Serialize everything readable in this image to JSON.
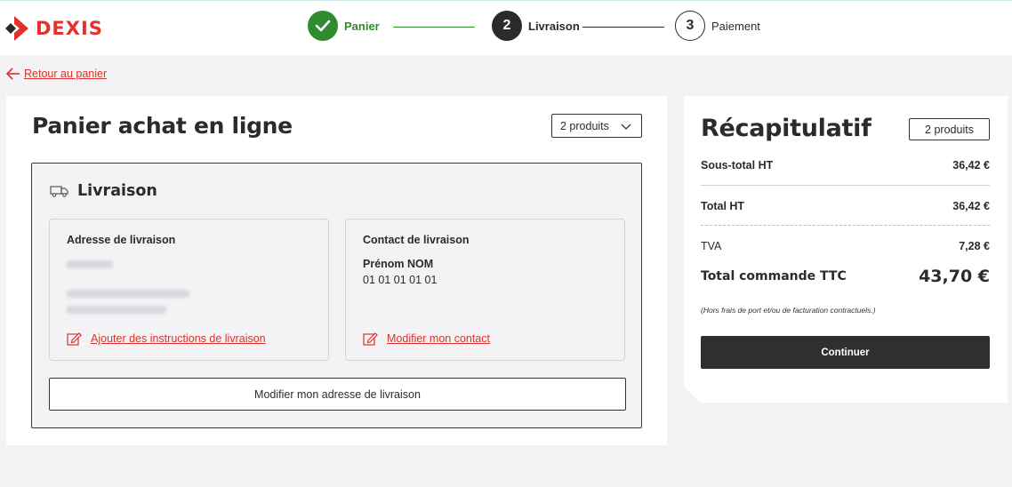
{
  "brand": {
    "name": "DEXIS",
    "accent": "#e3322d"
  },
  "steps": [
    {
      "number": "",
      "label": "Panier",
      "state": "done",
      "icon": "check-icon"
    },
    {
      "number": "2",
      "label": "Livraison",
      "state": "active"
    },
    {
      "number": "3",
      "label": "Paiement",
      "state": "todo"
    }
  ],
  "back_link": "Retour au panier",
  "cart": {
    "title": "Panier achat en ligne",
    "product_select": "2 produits",
    "delivery": {
      "heading": "Livraison",
      "address": {
        "title": "Adresse de livraison",
        "add_instructions_link": "Ajouter des instructions de livraison"
      },
      "contact": {
        "title": "Contact de livraison",
        "name": "Prénom NOM",
        "phone": "01 01 01 01 01",
        "edit_link": "Modifier mon contact"
      },
      "edit_address_button": "Modifier mon adresse de livraison"
    }
  },
  "summary": {
    "title": "Récapitulatif",
    "badge": "2 produits",
    "subtotal_label": "Sous-total HT",
    "subtotal_value": "36,42 €",
    "total_ht_label": "Total HT",
    "total_ht_value": "36,42 €",
    "tva_label": "TVA",
    "tva_value": "7,28 €",
    "total_ttc_label": "Total commande TTC",
    "total_ttc_value": "43,70 €",
    "note": "(Hors frais de port et/ou de facturation contractuels.)",
    "continue_button": "Continuer"
  }
}
